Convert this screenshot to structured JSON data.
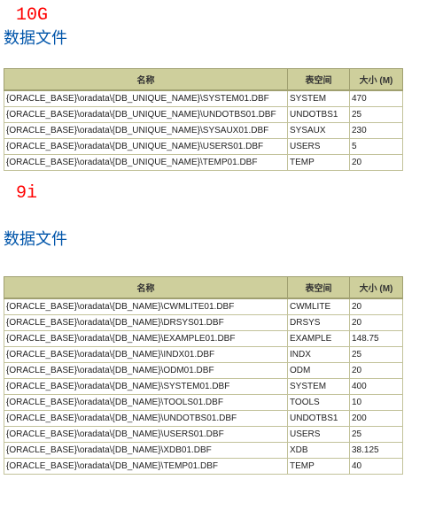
{
  "section10g": {
    "version_label": "10G",
    "title": "数据文件",
    "columns": {
      "name": "名称",
      "tablespace": "表空间",
      "size": "大小 (M)"
    },
    "rows": [
      {
        "name": "{ORACLE_BASE}\\oradata\\{DB_UNIQUE_NAME}\\SYSTEM01.DBF",
        "tablespace": "SYSTEM",
        "size": "470"
      },
      {
        "name": "{ORACLE_BASE}\\oradata\\{DB_UNIQUE_NAME}\\UNDOTBS01.DBF",
        "tablespace": "UNDOTBS1",
        "size": "25"
      },
      {
        "name": "{ORACLE_BASE}\\oradata\\{DB_UNIQUE_NAME}\\SYSAUX01.DBF",
        "tablespace": "SYSAUX",
        "size": "230"
      },
      {
        "name": "{ORACLE_BASE}\\oradata\\{DB_UNIQUE_NAME}\\USERS01.DBF",
        "tablespace": "USERS",
        "size": "5"
      },
      {
        "name": "{ORACLE_BASE}\\oradata\\{DB_UNIQUE_NAME}\\TEMP01.DBF",
        "tablespace": "TEMP",
        "size": "20"
      }
    ]
  },
  "section9i": {
    "version_label": "9i",
    "title": "数据文件",
    "columns": {
      "name": "名称",
      "tablespace": "表空间",
      "size": "大小 (M)"
    },
    "rows": [
      {
        "name": "{ORACLE_BASE}\\oradata\\{DB_NAME}\\CWMLITE01.DBF",
        "tablespace": "CWMLITE",
        "size": "20"
      },
      {
        "name": "{ORACLE_BASE}\\oradata\\{DB_NAME}\\DRSYS01.DBF",
        "tablespace": "DRSYS",
        "size": "20"
      },
      {
        "name": "{ORACLE_BASE}\\oradata\\{DB_NAME}\\EXAMPLE01.DBF",
        "tablespace": "EXAMPLE",
        "size": "148.75"
      },
      {
        "name": "{ORACLE_BASE}\\oradata\\{DB_NAME}\\INDX01.DBF",
        "tablespace": "INDX",
        "size": "25"
      },
      {
        "name": "{ORACLE_BASE}\\oradata\\{DB_NAME}\\ODM01.DBF",
        "tablespace": "ODM",
        "size": "20"
      },
      {
        "name": "{ORACLE_BASE}\\oradata\\{DB_NAME}\\SYSTEM01.DBF",
        "tablespace": "SYSTEM",
        "size": "400"
      },
      {
        "name": "{ORACLE_BASE}\\oradata\\{DB_NAME}\\TOOLS01.DBF",
        "tablespace": "TOOLS",
        "size": "10"
      },
      {
        "name": "{ORACLE_BASE}\\oradata\\{DB_NAME}\\UNDOTBS01.DBF",
        "tablespace": "UNDOTBS1",
        "size": "200"
      },
      {
        "name": "{ORACLE_BASE}\\oradata\\{DB_NAME}\\USERS01.DBF",
        "tablespace": "USERS",
        "size": "25"
      },
      {
        "name": "{ORACLE_BASE}\\oradata\\{DB_NAME}\\XDB01.DBF",
        "tablespace": "XDB",
        "size": "38.125"
      },
      {
        "name": "{ORACLE_BASE}\\oradata\\{DB_NAME}\\TEMP01.DBF",
        "tablespace": "TEMP",
        "size": "40"
      }
    ]
  }
}
